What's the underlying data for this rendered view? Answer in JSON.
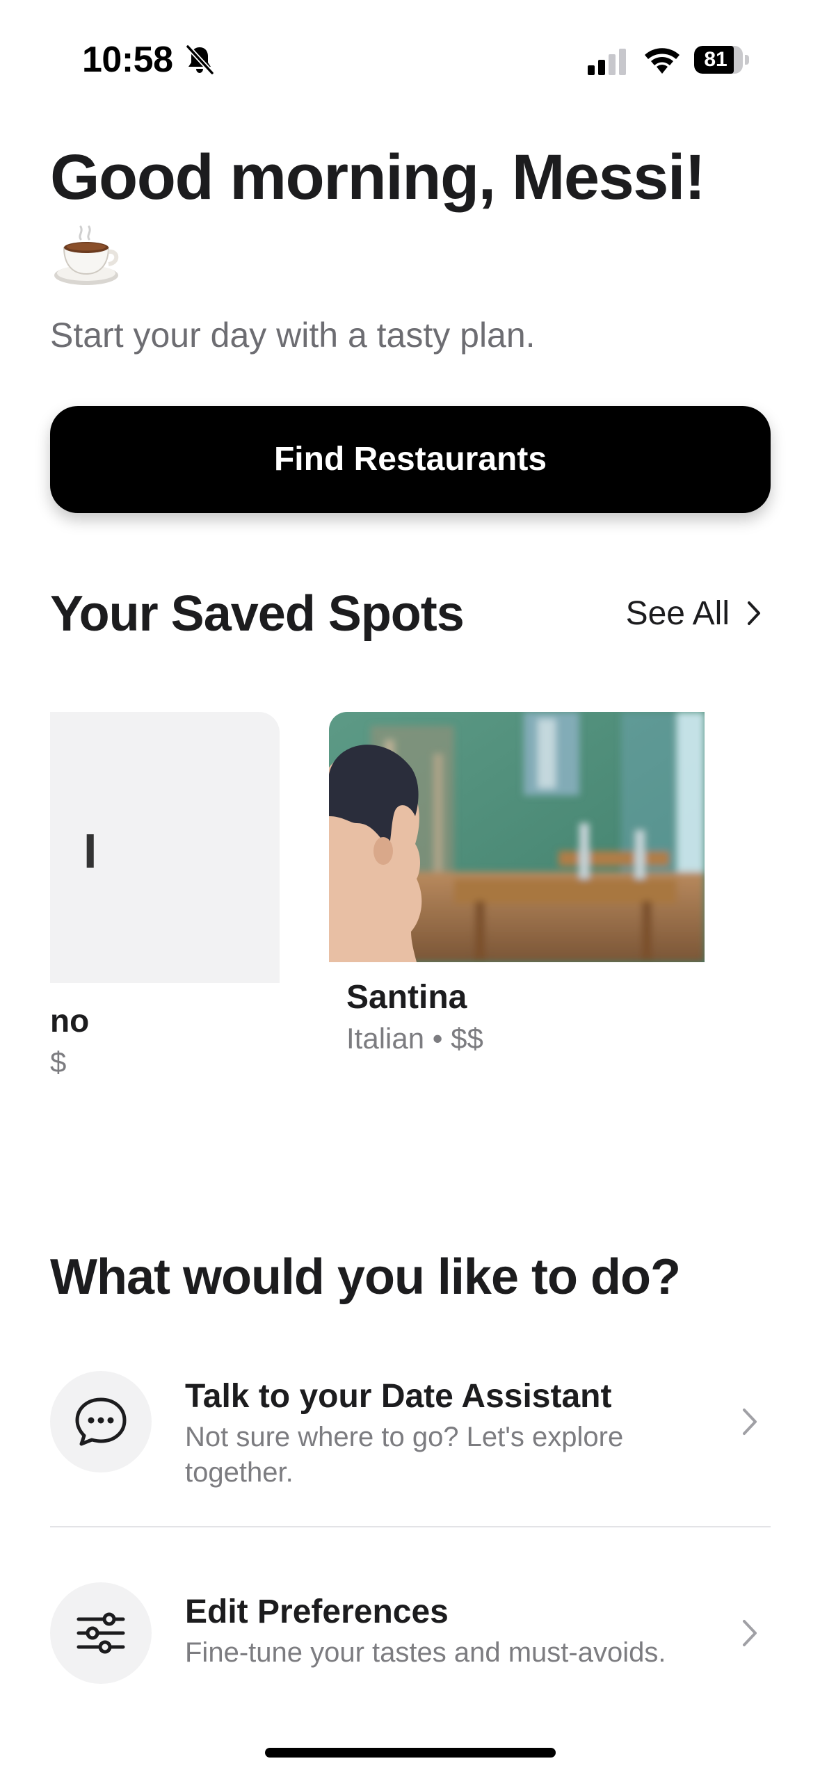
{
  "status_bar": {
    "time": "10:58",
    "battery_level": "81",
    "battery_fraction": 0.81,
    "icons": [
      "bell-slash-icon",
      "cellular-signal-icon",
      "wifi-icon",
      "battery-icon"
    ]
  },
  "header": {
    "greeting": "Good morning, Messi!",
    "emoji": "coffee-cup-icon",
    "subtitle": "Start your day with a tasty plan."
  },
  "primary_action": {
    "label": "Find Restaurants"
  },
  "saved_spots": {
    "title": "Your Saved Spots",
    "see_all_label": "See All",
    "items": [
      {
        "placeholder_letter": "I",
        "name": "no",
        "meta": "$"
      },
      {
        "name": "Santina",
        "meta": "Italian • $$"
      }
    ]
  },
  "actions": {
    "title": "What would you like to do?",
    "items": [
      {
        "icon": "chat-bubble-icon",
        "title": "Talk to your Date Assistant",
        "description": "Not sure where to go? Let's explore together."
      },
      {
        "icon": "sliders-icon",
        "title": "Edit Preferences",
        "description": "Fine-tune your tastes and must-avoids."
      }
    ]
  },
  "colors": {
    "primary_button": "#000000",
    "text_primary": "#1c1c1e",
    "text_secondary": "#7c7c80",
    "icon_background": "#f2f2f3"
  }
}
